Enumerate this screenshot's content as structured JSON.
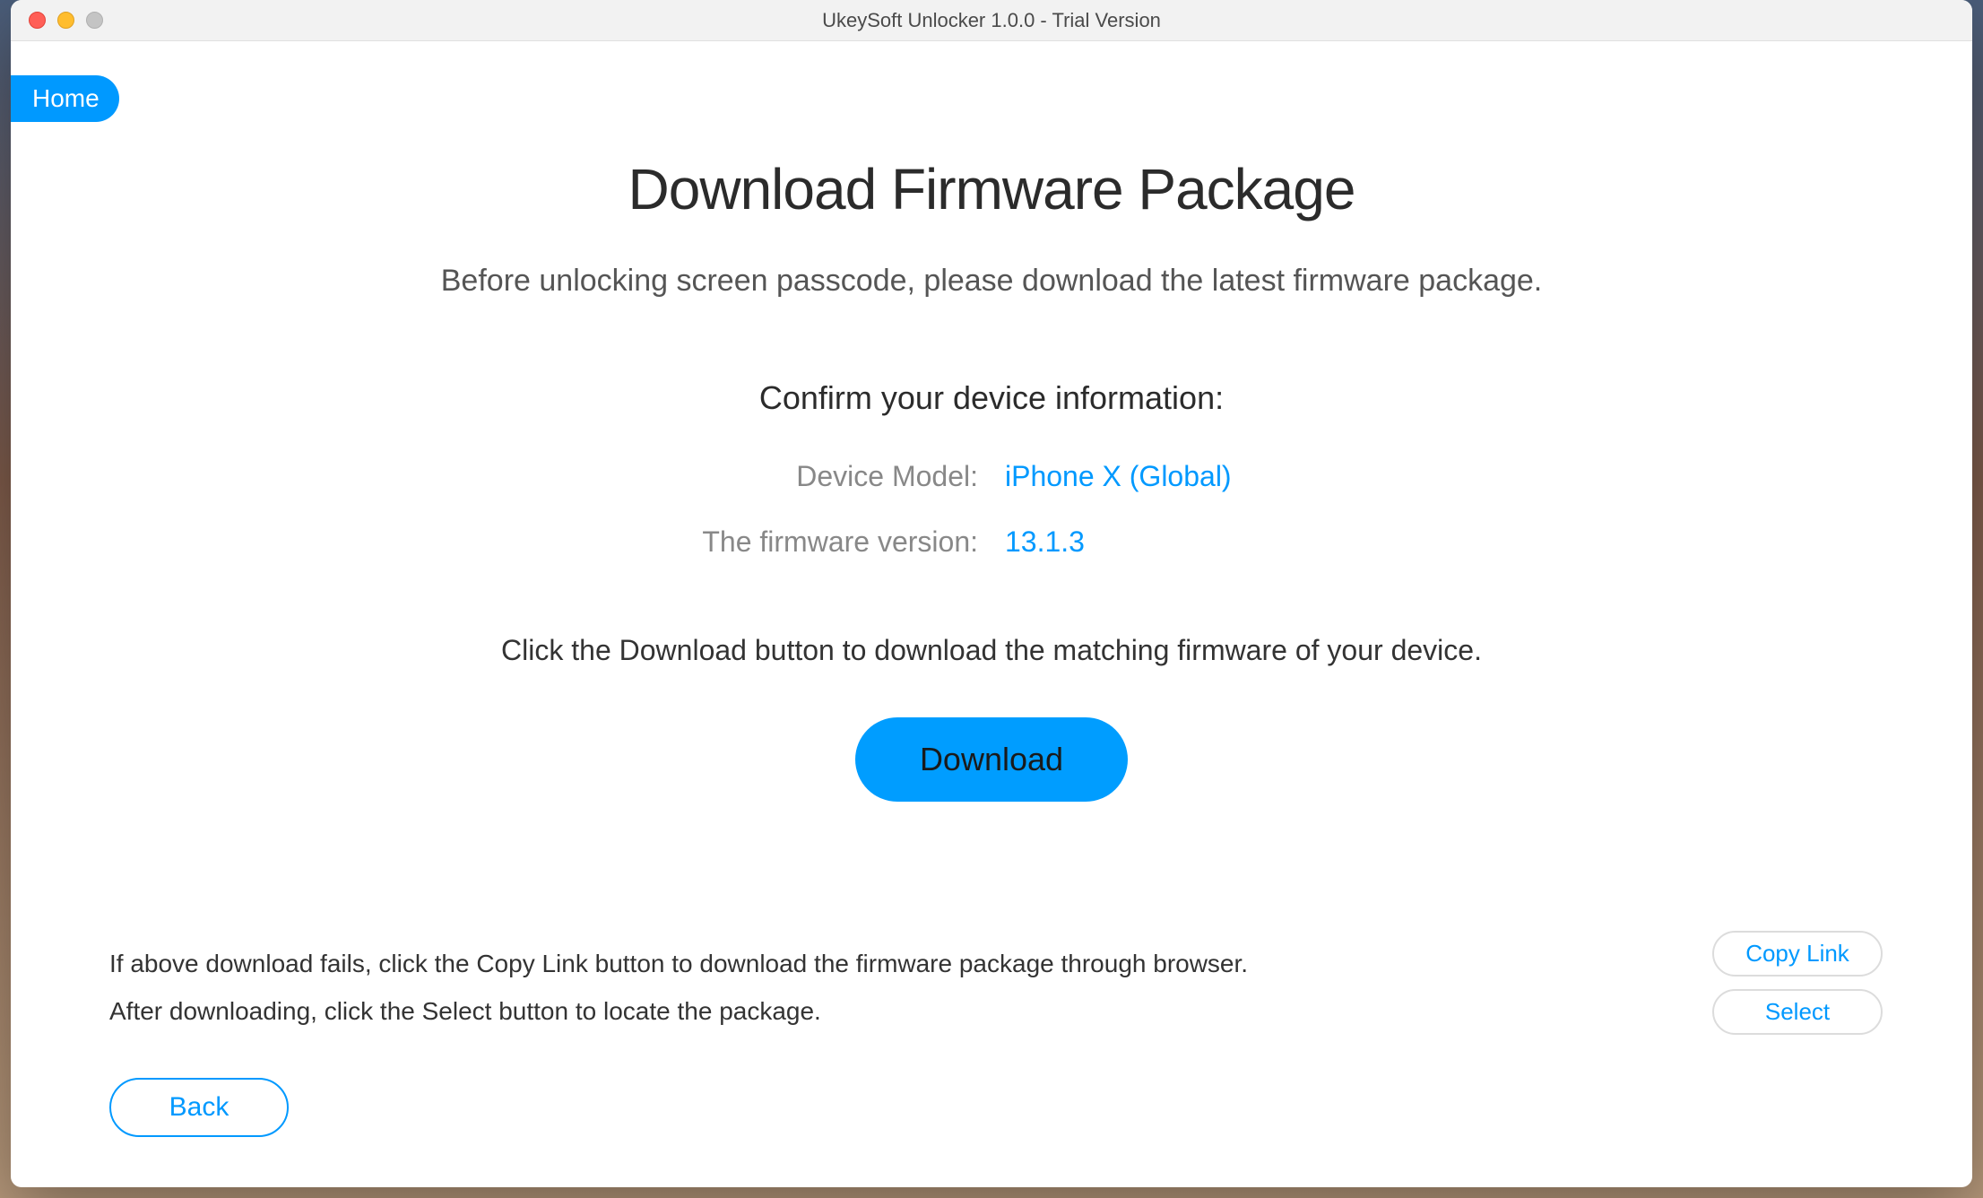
{
  "window": {
    "title": "UkeySoft Unlocker 1.0.0 - Trial Version"
  },
  "nav": {
    "home_label": "Home"
  },
  "main": {
    "title": "Download Firmware Package",
    "subtitle": "Before unlocking screen passcode, please download the latest firmware package.",
    "confirm_heading": "Confirm your device information:",
    "device_model_label": "Device Model:",
    "device_model_value": "iPhone X (Global)",
    "firmware_version_label": "The firmware version:",
    "firmware_version_value": "13.1.3",
    "click_instruction": "Click the Download button to download the matching firmware of your device.",
    "download_label": "Download"
  },
  "fallback": {
    "line1": "If above download fails, click the Copy Link button to download the firmware package through browser.",
    "line2": "After downloading, click the Select button to locate the package.",
    "copy_link_label": "Copy Link",
    "select_label": "Select"
  },
  "footer": {
    "back_label": "Back"
  },
  "colors": {
    "accent": "#0099ff"
  }
}
